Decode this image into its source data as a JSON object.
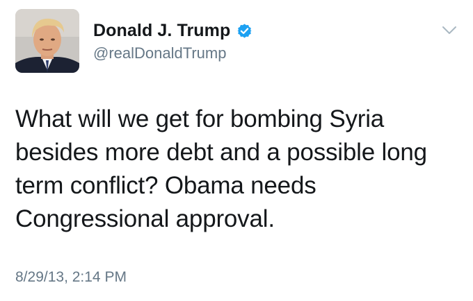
{
  "user": {
    "display_name": "Donald J. Trump",
    "handle": "@realDonaldTrump",
    "verified": true
  },
  "tweet": {
    "text": "What will we get for bombing Syria besides more debt and a possible long term conflict? Obama needs Congressional approval.",
    "timestamp": "8/29/13, 2:14 PM"
  },
  "icons": {
    "verified": "verified-badge-icon",
    "menu": "chevron-down-icon"
  },
  "colors": {
    "verified_blue": "#1da1f2",
    "secondary_text": "#657786",
    "primary_text": "#14171a"
  }
}
